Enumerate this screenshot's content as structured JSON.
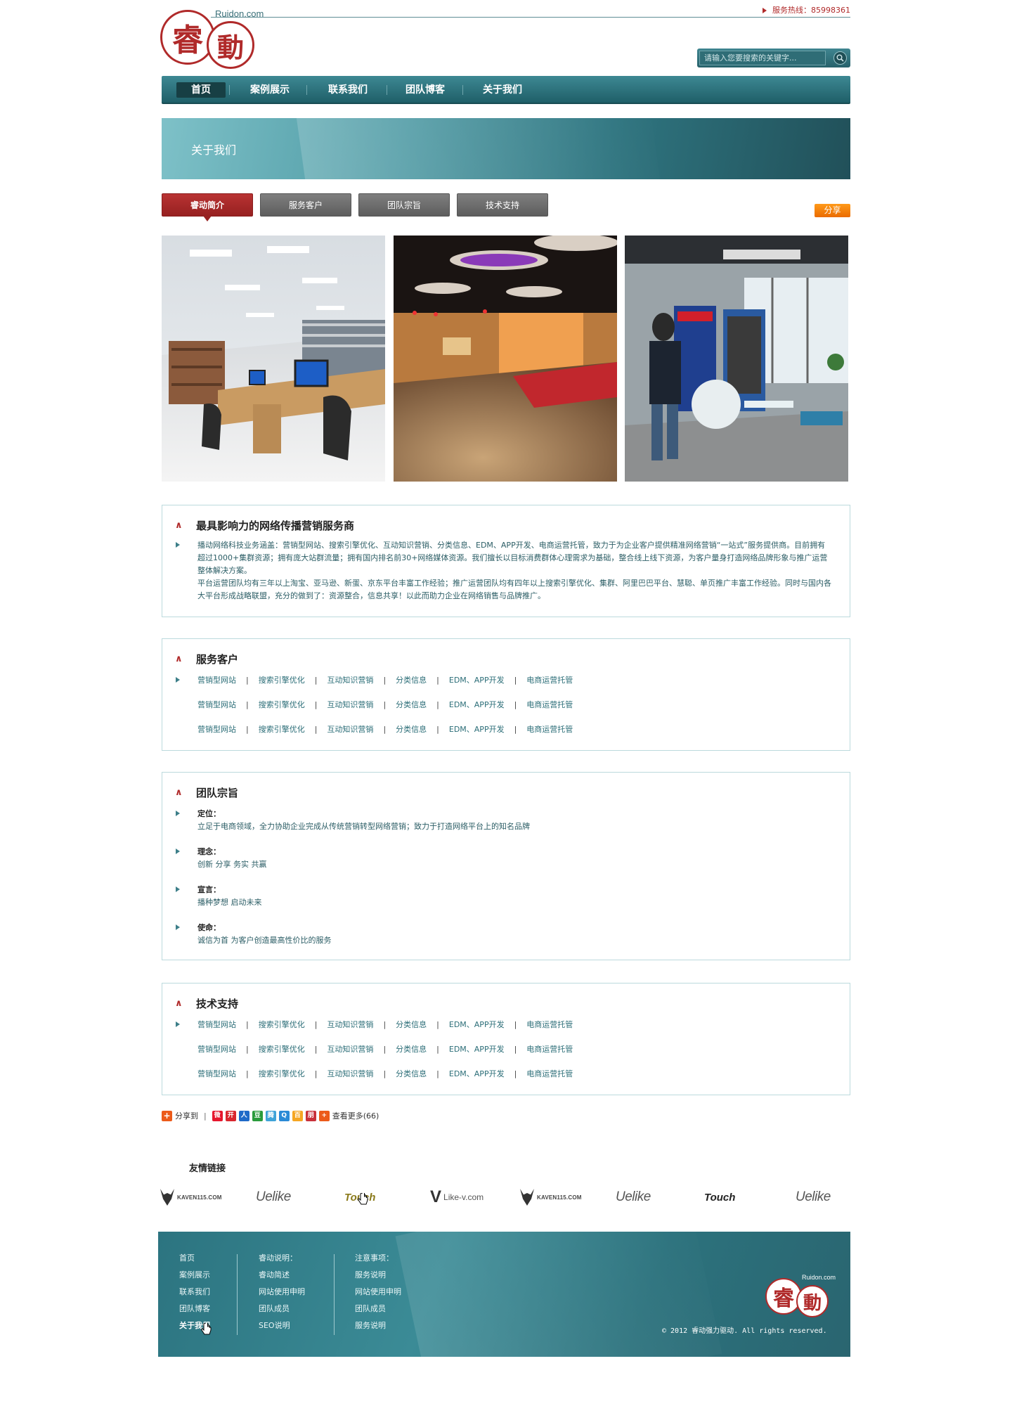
{
  "header": {
    "logo_domain": "Ruidon.com",
    "logo_char_1": "睿",
    "logo_char_2": "動",
    "hotline": "服务热线：85998361",
    "search_placeholder": "请输入您要搜索的关键字..."
  },
  "nav": {
    "items": [
      {
        "label": "首页",
        "active": true
      },
      {
        "label": "案例展示",
        "active": false
      },
      {
        "label": "联系我们",
        "active": false
      },
      {
        "label": "团队博客",
        "active": false
      },
      {
        "label": "关于我们",
        "active": false
      }
    ]
  },
  "banner": {
    "title": "关于我们"
  },
  "tabs": [
    {
      "label": "睿动简介",
      "active": true
    },
    {
      "label": "服务客户",
      "active": false
    },
    {
      "label": "团队宗旨",
      "active": false
    },
    {
      "label": "技术支持",
      "active": false
    }
  ],
  "share_button": "分享",
  "intro": {
    "title": "最具影响力的网络传播营销服务商",
    "paragraph_1": "播动网络科技业务涵盖：营销型网站、搜索引擎优化、互动知识营销、分类信息、EDM、APP开发、电商运营托管，致力于为企业客户提供精准网络营销“一站式”服务提供商。目前拥有超过1000+集群资源；拥有庞大站群流量；拥有国内排名前30+网络媒体资源。我们擅长以目标消费群体心理需求为基础，整合线上线下资源，为客户量身打造网络品牌形象与推广运营整体解决方案。",
    "paragraph_2": "平台运营团队均有三年以上淘宝、亚马逊、新蛋、京东平台丰富工作经验；推广运营团队均有四年以上搜索引擎优化、集群、阿里巴巴平台、慧聪、单页推广丰富工作经验。同时与国内各大平台形成战略联盟，充分的做到了：资源整合，信息共享！以此而助力企业在网络销售与品牌推广。"
  },
  "service_clients": {
    "title": "服务客户",
    "rows": [
      [
        "营销型网站",
        "搜索引擎优化",
        "互动知识营销",
        "分类信息",
        "EDM、APP开发",
        "电商运营托管"
      ],
      [
        "营销型网站",
        "搜索引擎优化",
        "互动知识营销",
        "分类信息",
        "EDM、APP开发",
        "电商运营托管"
      ],
      [
        "营销型网站",
        "搜索引擎优化",
        "互动知识营销",
        "分类信息",
        "EDM、APP开发",
        "电商运营托管"
      ]
    ]
  },
  "team_mission": {
    "title": "团队宗旨",
    "items": [
      {
        "label": "定位：",
        "text": "立足于电商领域，全力协助企业完成从传统营销转型网络营销；致力于打造网络平台上的知名品牌"
      },
      {
        "label": "理念：",
        "text": "创新 分享 务实 共赢"
      },
      {
        "label": "宣言：",
        "text": "播种梦想 启动未来"
      },
      {
        "label": "使命：",
        "text": "诚信为首 为客户创造最高性价比的服务"
      }
    ]
  },
  "tech_support": {
    "title": "技术支持",
    "rows": [
      [
        "营销型网站",
        "搜索引擎优化",
        "互动知识营销",
        "分类信息",
        "EDM、APP开发",
        "电商运营托管"
      ],
      [
        "营销型网站",
        "搜索引擎优化",
        "互动知识营销",
        "分类信息",
        "EDM、APP开发",
        "电商运营托管"
      ],
      [
        "营销型网站",
        "搜索引擎优化",
        "互动知识营销",
        "分类信息",
        "EDM、APP开发",
        "电商运营托管"
      ]
    ]
  },
  "share_bar": {
    "share_to": "分享到",
    "divider": "|",
    "more": "查看更多(66)",
    "icons": [
      {
        "name": "weibo-icon",
        "color": "#e6162d",
        "glyph": "微"
      },
      {
        "name": "kaixin-icon",
        "color": "#d9262e",
        "glyph": "开"
      },
      {
        "name": "renren-icon",
        "color": "#1f6ac8",
        "glyph": "人"
      },
      {
        "name": "douban-icon",
        "color": "#2a9b3c",
        "glyph": "豆"
      },
      {
        "name": "tencent-weibo-icon",
        "color": "#3fa3d8",
        "glyph": "腾"
      },
      {
        "name": "qq-zone-icon",
        "color": "#2a8ad6",
        "glyph": "Q"
      },
      {
        "name": "baidu-icon",
        "color": "#f5a623",
        "glyph": "百"
      },
      {
        "name": "pengyou-icon",
        "color": "#c8313b",
        "glyph": "朋"
      },
      {
        "name": "more-icon",
        "color": "#ec5b1a",
        "glyph": "+"
      }
    ]
  },
  "friend_links": {
    "title": "友情链接",
    "partners": [
      {
        "type": "kaven",
        "text": "KAVEN115.COM"
      },
      {
        "type": "uelike",
        "text": "Uelike"
      },
      {
        "type": "touch-gold",
        "text": "Touch"
      },
      {
        "type": "likev",
        "text": "Like-v.com"
      },
      {
        "type": "kaven",
        "text": "KAVEN115.COM"
      },
      {
        "type": "uelike",
        "text": "Uelike"
      },
      {
        "type": "touch",
        "text": "Touch"
      },
      {
        "type": "uelike",
        "text": "Uelike"
      }
    ]
  },
  "footer": {
    "col1": [
      "首页",
      "案例展示",
      "联系我们",
      "团队博客",
      "关于我们"
    ],
    "col2": [
      "睿动说明：",
      "睿动简述",
      "网站使用申明",
      "团队成员",
      "SEO说明"
    ],
    "col3": [
      "注意事项：",
      "服务说明",
      "网站使用申明",
      "团队成员",
      "服务说明"
    ],
    "copyright": "© 2012 睿动强力驱动. All rights reserved.",
    "logo_domain": "Ruidon.com",
    "logo_char_1": "睿",
    "logo_char_2": "動"
  },
  "colors": {
    "brand_red": "#b02a2a",
    "teal": "#2f7580",
    "orange": "#ea6b00"
  }
}
